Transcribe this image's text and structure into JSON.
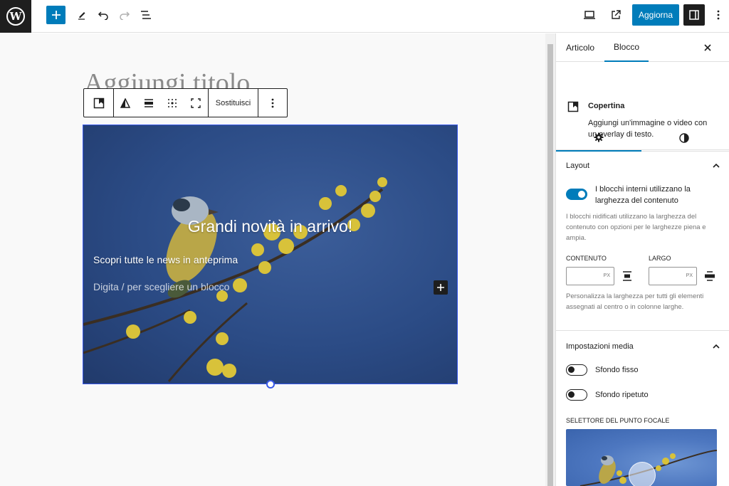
{
  "topbar": {
    "logo_letter": "W",
    "update_label": "Aggiorna"
  },
  "editor": {
    "title_placeholder": "Aggiungi titolo",
    "block_toolbar": {
      "replace_label": "Sostituisci"
    },
    "cover": {
      "heading": "Grandi novità in arrivo!",
      "paragraph": "Scopri tutte le news in anteprima",
      "placeholder": "Digita / per scegliere un blocco"
    }
  },
  "sidebar": {
    "tabs": [
      "Articolo",
      "Blocco"
    ],
    "block": {
      "name": "Copertina",
      "description": "Aggiungi un'immagine o video con un overlay di testo."
    },
    "layout": {
      "title": "Layout",
      "toggle_label": "I blocchi interni utilizzano la larghezza del contenuto",
      "help": "I blocchi nidificati utilizzano la larghezza del contenuto con opzioni per le larghezze piena e ampia.",
      "content_label": "CONTENUTO",
      "wide_label": "LARGO",
      "unit": "PX",
      "footer_help": "Personalizza la larghezza per tutti gli elementi assegnati al centro o in colonne larghe."
    },
    "media": {
      "title": "Impostazioni media",
      "fixed_bg": "Sfondo fisso",
      "repeat_bg": "Sfondo ripetuto",
      "focal_label": "SELETTORE DEL PUNTO FOCALE"
    }
  },
  "colors": {
    "accent": "#007cba",
    "selection": "#3858e9",
    "dark": "#1e1e1e"
  }
}
